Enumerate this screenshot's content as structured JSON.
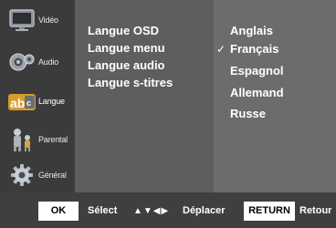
{
  "categories": [
    {
      "label": "Vidéo",
      "icon": "tv-icon"
    },
    {
      "label": "Audio",
      "icon": "speaker-icon"
    },
    {
      "label": "Langue",
      "icon": "language-icon"
    },
    {
      "label": "Parental",
      "icon": "parental-icon"
    },
    {
      "label": "Général",
      "icon": "gear-icon"
    }
  ],
  "active_category": "Langue",
  "submenu": [
    {
      "label": "Langue OSD"
    },
    {
      "label": "Langue menu"
    },
    {
      "label": "Langue audio"
    },
    {
      "label": "Langue s-titres"
    }
  ],
  "options": [
    {
      "label": "Anglais"
    },
    {
      "label": "Français"
    },
    {
      "label": "Espagnol"
    },
    {
      "label": "Allemand"
    },
    {
      "label": "Russe"
    }
  ],
  "selected_option": "Français",
  "check_symbol": "✓",
  "bottom_bar": {
    "ok_key": "OK",
    "ok_action": "Sélect",
    "arrows": "▲▼◀▶",
    "move_action": "Déplacer",
    "return_key": "RETURN",
    "return_action": "Retour"
  },
  "colors": {
    "background": "#4f4f4f",
    "category_column": "#3b3b3b",
    "submenu_panel": "#5e5e5e",
    "options_panel": "#6c6c6c",
    "bottom_bar": "#3f3f3f",
    "key_background": "#ffffff",
    "text": "#ffffff"
  }
}
